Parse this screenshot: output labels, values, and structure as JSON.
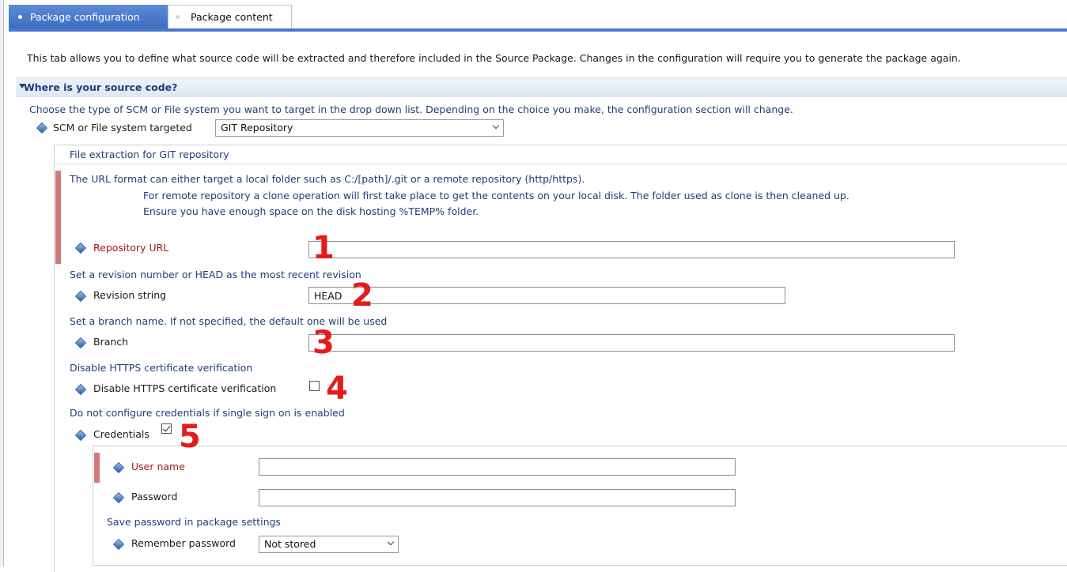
{
  "tabs": {
    "active_label": "Package configuration",
    "inactive_label": "Package content"
  },
  "intro_text": "This tab allows you to define what source code will be extracted and therefore included in the Source Package. Changes in the configuration will require you to generate the package again.",
  "section": {
    "title": "Where is your source code?",
    "description": "Choose the type of SCM or File system you want to target in the drop down list. Depending on the choice you make, the configuration section will change.",
    "scm_label": "SCM or File system targeted",
    "scm_value": "GIT Repository"
  },
  "git": {
    "panel_title": "File extraction for GIT repository",
    "url_help_1": "The URL format can either target a local folder such as C:/[path]/.git or a remote repository (http/https).",
    "url_help_2": "For remote repository a clone operation will first take place to get the contents on your local disk. The folder used as clone is then cleaned up.",
    "url_help_3": "Ensure you have enough space on the disk hosting %TEMP% folder.",
    "repo_url_label": "Repository URL",
    "repo_url_value": "",
    "revision_help": "Set a revision number or HEAD as the most recent revision",
    "revision_label": "Revision string",
    "revision_value": "HEAD",
    "branch_help": "Set a branch name. If not specified, the default one will be used",
    "branch_label": "Branch",
    "branch_value": "",
    "https_help": "Disable HTTPS certificate verification",
    "https_label": "Disable HTTPS certificate verification",
    "https_checked": false,
    "cred_help": "Do not configure credentials if single sign on is enabled",
    "cred_label": "Credentials",
    "cred_checked": true
  },
  "credentials": {
    "username_label": "User name",
    "username_value": "",
    "password_label": "Password",
    "password_value": "",
    "save_help": "Save password in package settings",
    "remember_label": "Remember password",
    "remember_value": "Not stored"
  },
  "annotations": [
    "1",
    "2",
    "3",
    "4",
    "5"
  ],
  "colors": {
    "tab_active": "#4b78cc",
    "required_label": "#a01818",
    "description_text": "#1f3e7a",
    "annotation": "#e51b1b"
  }
}
